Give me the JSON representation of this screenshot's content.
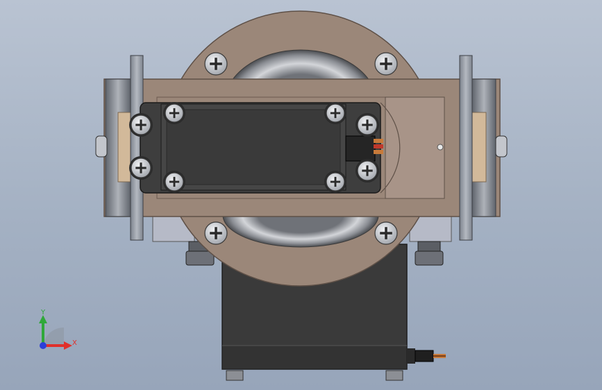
{
  "view": {
    "background_top": "#b9c3d2",
    "background_bottom": "#97a5ba"
  },
  "triad": {
    "x_label": "X",
    "y_label": "Y",
    "x_color": "#e0302a",
    "y_color": "#2fa83a",
    "z_color": "#2b3fd8"
  },
  "colors": {
    "plate": "#9b8779",
    "plate_edge": "#5e5047",
    "servo_body": "#3b3b3b",
    "bracket": "#9aa0aa",
    "bearing": "#c7c9ce",
    "screw": "#d9dbe0",
    "wire_red": "#c0392b",
    "wire_copper": "#c77a3a"
  }
}
